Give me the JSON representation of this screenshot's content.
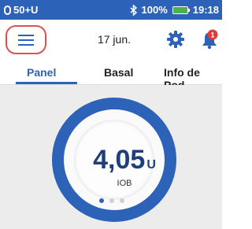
{
  "status_bar": {
    "pod_status": "50+U",
    "battery_percent": "100%",
    "time": "19:18",
    "colors": {
      "background": "#2c62b7",
      "battery": "#4caf50"
    }
  },
  "header": {
    "menu_icon": "hamburger-menu-icon",
    "date": "17 jun.",
    "settings_icon": "gear-icon",
    "notifications_icon": "bell-icon",
    "notification_count": "1"
  },
  "tabs": [
    {
      "label": "Panel",
      "active": true
    },
    {
      "label": "Basal",
      "active": false
    },
    {
      "label": "Info de Pod",
      "active": false
    }
  ],
  "dashboard": {
    "iob_value": "4,05",
    "iob_unit": "U",
    "iob_label": "IOB",
    "page_indicator": {
      "total": 3,
      "current": 1
    }
  }
}
